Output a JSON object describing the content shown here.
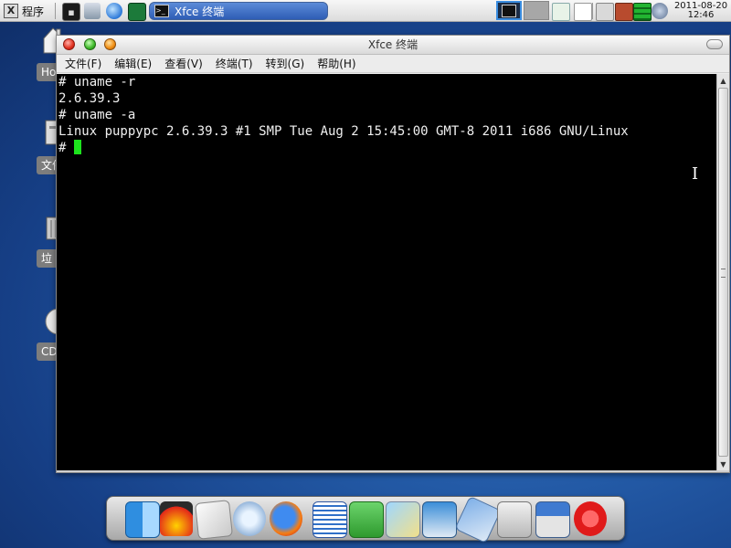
{
  "top_panel": {
    "menu_label": "程序",
    "task_title": "Xfce 终端",
    "clock_date": "2011-08-20",
    "clock_time": "12:46"
  },
  "desktop_icons": [
    {
      "label": "Ho"
    },
    {
      "label": "文件"
    },
    {
      "label": "垃"
    },
    {
      "label": "CD"
    }
  ],
  "window": {
    "title": "Xfce 终端",
    "menus": [
      "文件(F)",
      "编辑(E)",
      "查看(V)",
      "终端(T)",
      "转到(G)",
      "帮助(H)"
    ]
  },
  "terminal": {
    "lines": [
      "# uname -r",
      "2.6.39.3",
      "# uname -a",
      "Linux puppypc 2.6.39.3 #1 SMP Tue Aug 2 15:45:00 GMT-8 2011 i686 GNU/Linux",
      "# "
    ],
    "cursor_color": "#1de31d"
  },
  "dock": {
    "icons": [
      "finder-icon",
      "shell-icon",
      "writer-icon",
      "music-icon",
      "firefox-icon",
      "docs-icon",
      "spreadsheet-icon",
      "paint-icon",
      "photo-icon",
      "usb-icon",
      "settings-icon",
      "install-icon",
      "power-icon"
    ]
  },
  "colors": {
    "accent": "#2e5db5",
    "terminal_bg": "#000000",
    "terminal_fg": "#f0f0f0"
  }
}
